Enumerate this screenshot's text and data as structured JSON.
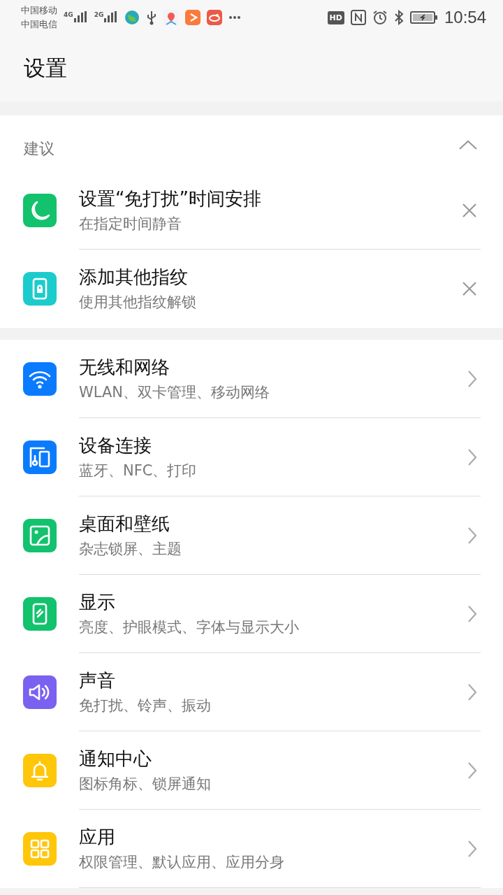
{
  "status_bar": {
    "carriers": [
      "中国移动",
      "中国电信"
    ],
    "networks": [
      "4G",
      "2G"
    ],
    "hd": "HD",
    "time": "10:54"
  },
  "header": {
    "title": "设置"
  },
  "suggestions": {
    "title": "建议",
    "expanded": true,
    "items": [
      {
        "title": "设置“免打扰”时间安排",
        "subtitle": "在指定时间静音",
        "color": "#12c26d"
      },
      {
        "title": "添加其他指纹",
        "subtitle": "使用其他指纹解锁",
        "color": "#1ccccc"
      }
    ]
  },
  "settings": [
    {
      "title": "无线和网络",
      "subtitle": "WLAN、双卡管理、移动网络",
      "color": "#0a7bff"
    },
    {
      "title": "设备连接",
      "subtitle": "蓝牙、NFC、打印",
      "color": "#0a7bff"
    },
    {
      "title": "桌面和壁纸",
      "subtitle": "杂志锁屏、主题",
      "color": "#12c26d"
    },
    {
      "title": "显示",
      "subtitle": "亮度、护眼模式、字体与显示大小",
      "color": "#12c26d"
    },
    {
      "title": "声音",
      "subtitle": "免打扰、铃声、振动",
      "color": "#7b61f0"
    },
    {
      "title": "通知中心",
      "subtitle": "图标角标、锁屏通知",
      "color": "#ffc60a"
    },
    {
      "title": "应用",
      "subtitle": "权限管理、默认应用、应用分身",
      "color": "#ffc60a"
    }
  ]
}
